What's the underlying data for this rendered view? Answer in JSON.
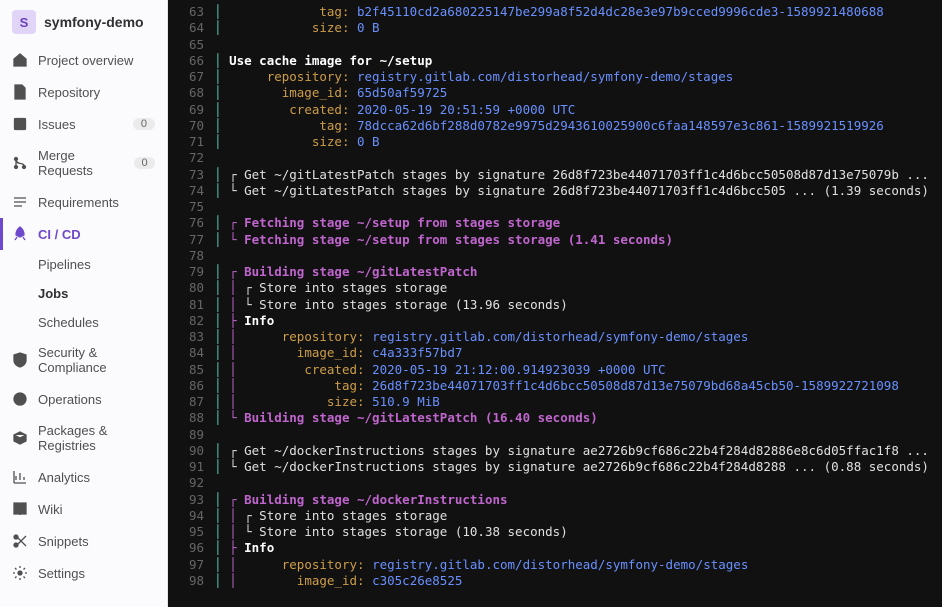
{
  "project": {
    "avatar_letter": "S",
    "name": "symfony-demo"
  },
  "nav": {
    "overview": "Project overview",
    "repository": "Repository",
    "issues": "Issues",
    "issues_count": "0",
    "mrs": "Merge Requests",
    "mrs_count": "0",
    "requirements": "Requirements",
    "cicd": "CI / CD",
    "cicd_sub": {
      "pipelines": "Pipelines",
      "jobs": "Jobs",
      "schedules": "Schedules"
    },
    "security": "Security & Compliance",
    "operations": "Operations",
    "packages": "Packages & Registries",
    "analytics": "Analytics",
    "wiki": "Wiki",
    "snippets": "Snippets",
    "settings": "Settings"
  },
  "log": {
    "lines": [
      {
        "n": 63,
        "h": "<span class='cy'>│             </span><span class='ye'>tag: </span><span class='bl'>b2f45110cd2a680225147be299a8f52d4dc28e3e97b9cced9996cde3-1589921480688</span>"
      },
      {
        "n": 64,
        "h": "<span class='cy'>│            </span><span class='ye'>size: </span><span class='bl'>0 B</span>"
      },
      {
        "n": 65,
        "h": ""
      },
      {
        "n": 66,
        "h": "<span class='cy'>│ </span><span class='bw'>Use cache image for ~/setup</span>"
      },
      {
        "n": 67,
        "h": "<span class='cy'>│      </span><span class='ye'>repository: </span><span class='bl'>registry.gitlab.com/distorhead/symfony-demo/stages</span>"
      },
      {
        "n": 68,
        "h": "<span class='cy'>│        </span><span class='ye'>image_id: </span><span class='bl'>65d50af59725</span>"
      },
      {
        "n": 69,
        "h": "<span class='cy'>│         </span><span class='ye'>created: </span><span class='bl'>2020-05-19 20:51:59 +0000 UTC</span>"
      },
      {
        "n": 70,
        "h": "<span class='cy'>│             </span><span class='ye'>tag: </span><span class='bl'>78dcca62d6bf288d0782e9975d2943610025900c6faa148597e3c861-1589921519926</span>"
      },
      {
        "n": 71,
        "h": "<span class='cy'>│            </span><span class='ye'>size: </span><span class='bl'>0 B</span>"
      },
      {
        "n": 72,
        "h": ""
      },
      {
        "n": 73,
        "h": "<span class='cy'>│ </span>┌ Get ~/gitLatestPatch stages by signature 26d8f723be44071703ff1c4d6bcc50508d87d13e75079b ..."
      },
      {
        "n": 74,
        "h": "<span class='cy'>│ </span>└ Get ~/gitLatestPatch stages by signature 26d8f723be44071703ff1c4d6bcc505 ... (1.39 seconds)"
      },
      {
        "n": 75,
        "h": ""
      },
      {
        "n": 76,
        "h": "<span class='cy'>│ </span><span class='mg'>┌ </span><span class='bm'>Fetching stage ~/setup from stages storage</span>"
      },
      {
        "n": 77,
        "h": "<span class='cy'>│ </span><span class='mg'>└ </span><span class='bm'>Fetching stage ~/setup from stages storage (1.41 seconds)</span>"
      },
      {
        "n": 78,
        "h": ""
      },
      {
        "n": 79,
        "h": "<span class='cy'>│ </span><span class='mg'>┌ </span><span class='bm'>Building stage ~/gitLatestPatch</span>"
      },
      {
        "n": 80,
        "h": "<span class='cy'>│ </span><span class='mg'>│ </span>┌ Store into stages storage"
      },
      {
        "n": 81,
        "h": "<span class='cy'>│ </span><span class='mg'>│ </span>└ Store into stages storage (13.96 seconds)"
      },
      {
        "n": 82,
        "h": "<span class='cy'>│ </span><span class='mg'>├ </span><span class='bw'>Info</span>"
      },
      {
        "n": 83,
        "h": "<span class='cy'>│ </span><span class='mg'>│      </span><span class='ye'>repository: </span><span class='bl'>registry.gitlab.com/distorhead/symfony-demo/stages</span>"
      },
      {
        "n": 84,
        "h": "<span class='cy'>│ </span><span class='mg'>│        </span><span class='ye'>image_id: </span><span class='bl'>c4a333f57bd7</span>"
      },
      {
        "n": 85,
        "h": "<span class='cy'>│ </span><span class='mg'>│         </span><span class='ye'>created: </span><span class='bl'>2020-05-19 21:12:00.914923039 +0000 UTC</span>"
      },
      {
        "n": 86,
        "h": "<span class='cy'>│ </span><span class='mg'>│             </span><span class='ye'>tag: </span><span class='bl'>26d8f723be44071703ff1c4d6bcc50508d87d13e75079bd68a45cb50-1589922721098</span>"
      },
      {
        "n": 87,
        "h": "<span class='cy'>│ </span><span class='mg'>│            </span><span class='ye'>size: </span><span class='bl'>510.9 MiB</span>"
      },
      {
        "n": 88,
        "h": "<span class='cy'>│ </span><span class='mg'>└ </span><span class='bm'>Building stage ~/gitLatestPatch (16.40 seconds)</span>"
      },
      {
        "n": 89,
        "h": ""
      },
      {
        "n": 90,
        "h": "<span class='cy'>│ </span>┌ Get ~/dockerInstructions stages by signature ae2726b9cf686c22b4f284d82886e8c6d05ffac1f8 ..."
      },
      {
        "n": 91,
        "h": "<span class='cy'>│ </span>└ Get ~/dockerInstructions stages by signature ae2726b9cf686c22b4f284d8288 ... (0.88 seconds)"
      },
      {
        "n": 92,
        "h": ""
      },
      {
        "n": 93,
        "h": "<span class='cy'>│ </span><span class='mg'>┌ </span><span class='bm'>Building stage ~/dockerInstructions</span>"
      },
      {
        "n": 94,
        "h": "<span class='cy'>│ </span><span class='mg'>│ </span>┌ Store into stages storage"
      },
      {
        "n": 95,
        "h": "<span class='cy'>│ </span><span class='mg'>│ </span>└ Store into stages storage (10.38 seconds)"
      },
      {
        "n": 96,
        "h": "<span class='cy'>│ </span><span class='mg'>├ </span><span class='bw'>Info</span>"
      },
      {
        "n": 97,
        "h": "<span class='cy'>│ </span><span class='mg'>│      </span><span class='ye'>repository: </span><span class='bl'>registry.gitlab.com/distorhead/symfony-demo/stages</span>"
      },
      {
        "n": 98,
        "h": "<span class='cy'>│ </span><span class='mg'>│        </span><span class='ye'>image_id: </span><span class='bl'>c305c26e8525</span>"
      }
    ]
  }
}
